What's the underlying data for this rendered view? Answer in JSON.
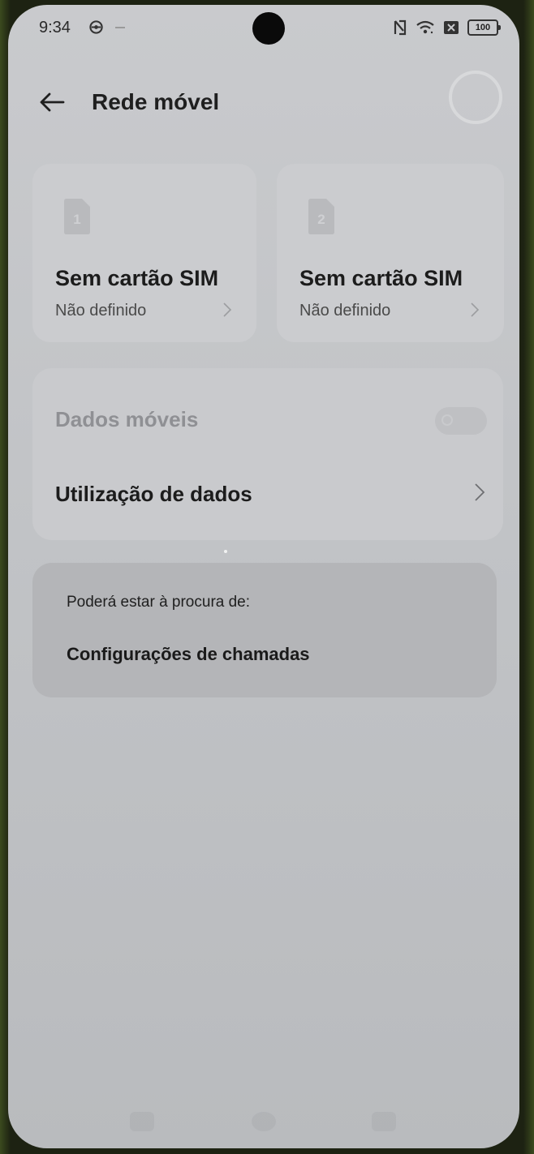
{
  "status_bar": {
    "time": "9:34",
    "battery": "100",
    "icons": [
      "settings-gear-icon",
      "nfc-icon",
      "wifi-icon",
      "no-sim-icon",
      "battery-icon"
    ]
  },
  "header": {
    "title": "Rede móvel",
    "back_icon": "back-arrow-icon"
  },
  "sim_cards": [
    {
      "slot": "1",
      "title": "Sem cartão SIM",
      "subtitle": "Não definido"
    },
    {
      "slot": "2",
      "title": "Sem cartão SIM",
      "subtitle": "Não definido"
    }
  ],
  "data_settings": {
    "mobile_data": {
      "label": "Dados móveis",
      "enabled": false
    },
    "data_usage": {
      "label": "Utilização de dados"
    }
  },
  "suggestions": {
    "label": "Poderá estar à procura de:",
    "items": [
      "Configurações de chamadas"
    ]
  },
  "colors": {
    "background": "#c4c6c9",
    "card": "#cbcccf",
    "suggestion_card": "#b4b5b8",
    "text_primary": "#1c1c1c",
    "text_disabled": "#8f9094"
  }
}
